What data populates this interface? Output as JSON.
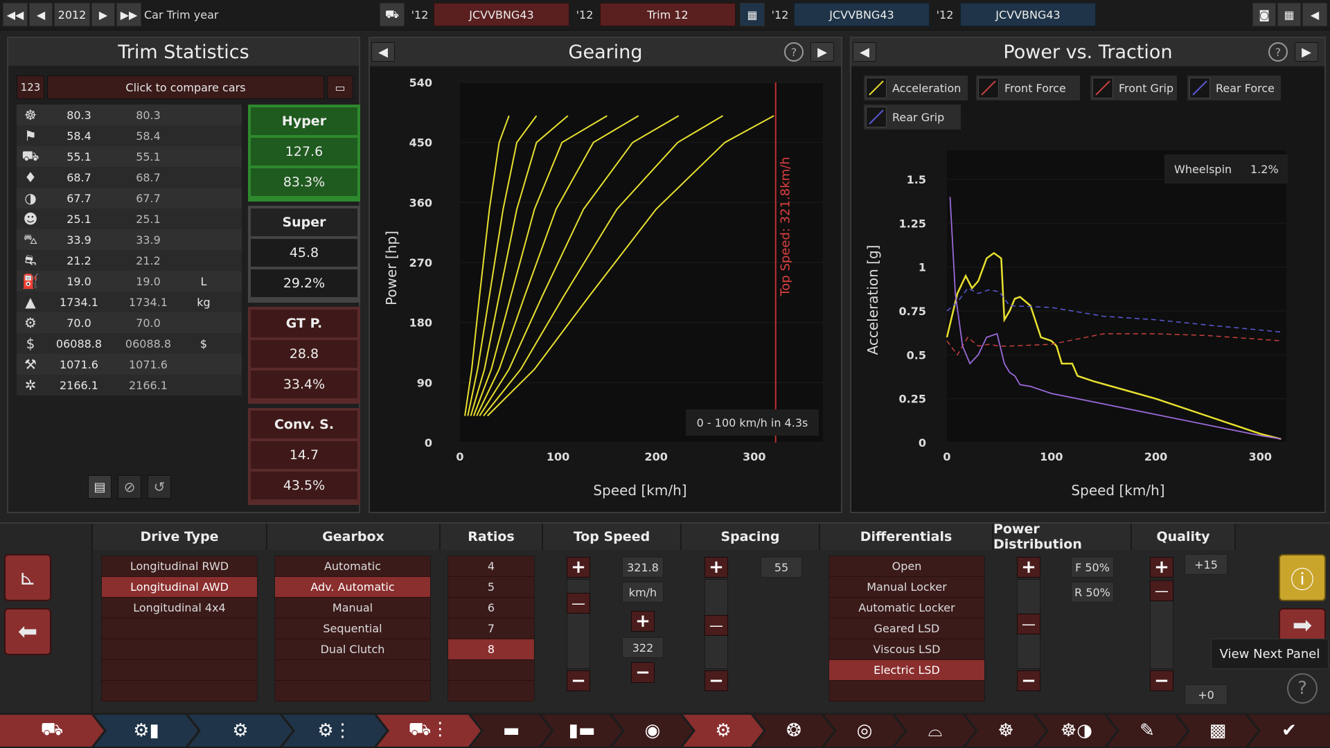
{
  "topbar": {
    "year": "2012",
    "year_label": "Car Trim year",
    "car_year_a": "'12",
    "car_a": "JCVVBNG43",
    "trim_year": "'12",
    "trim": "Trim 12",
    "car_year_b": "'12",
    "car_b": "JCVVBNG43",
    "car_year_c": "'12",
    "car_c": "JCVVBNG43"
  },
  "trim_stats": {
    "title": "Trim Statistics",
    "compare_num": "123",
    "compare_label": "Click to compare cars",
    "rows": [
      {
        "icon": "steering-wheel-icon",
        "glyph": "☸",
        "v1": "80.3",
        "v2": "80.3",
        "unit": ""
      },
      {
        "icon": "race-flag-icon",
        "glyph": "⚑",
        "v1": "58.4",
        "v2": "58.4",
        "unit": ""
      },
      {
        "icon": "seat-icon",
        "glyph": "⛟",
        "v1": "55.1",
        "v2": "55.1",
        "unit": ""
      },
      {
        "icon": "gem-icon",
        "glyph": "♦",
        "v1": "68.7",
        "v2": "68.7",
        "unit": ""
      },
      {
        "icon": "safety-icon",
        "glyph": "◑",
        "v1": "67.7",
        "v2": "67.7",
        "unit": ""
      },
      {
        "icon": "people-icon",
        "glyph": "☻",
        "v1": "25.1",
        "v2": "25.1",
        "unit": ""
      },
      {
        "icon": "car-side-icon",
        "glyph": "⛍",
        "v1": "33.9",
        "v2": "33.9",
        "unit": ""
      },
      {
        "icon": "car-wrench-icon",
        "glyph": "⛐",
        "v1": "21.2",
        "v2": "21.2",
        "unit": ""
      },
      {
        "icon": "fuel-icon",
        "glyph": "⛽",
        "v1": "19.0",
        "v2": "19.0",
        "unit": "L"
      },
      {
        "icon": "weight-icon",
        "glyph": "▲",
        "v1": "1734.1",
        "v2": "1734.1",
        "unit": "kg"
      },
      {
        "icon": "engine-hand-icon",
        "glyph": "⚙",
        "v1": "70.0",
        "v2": "70.0",
        "unit": ""
      },
      {
        "icon": "money-bag-icon",
        "glyph": "$",
        "v1": "06088.8",
        "v2": "06088.8",
        "unit": "$"
      },
      {
        "icon": "production-icon",
        "glyph": "⚒",
        "v1": "1071.6",
        "v2": "1071.6",
        "unit": ""
      },
      {
        "icon": "gears-icon",
        "glyph": "✲",
        "v1": "2166.1",
        "v2": "2166.1",
        "unit": ""
      }
    ],
    "classes": [
      {
        "name": "Hyper",
        "score": "127.6",
        "pct": "83.3%",
        "bg": "#1f5a1f",
        "border": "#2d8a2d"
      },
      {
        "name": "Super",
        "score": "45.8",
        "pct": "29.2%",
        "bg": "#1b1b1b",
        "border": "#444444"
      },
      {
        "name": "GT P.",
        "score": "28.8",
        "pct": "33.4%",
        "bg": "#3f1919",
        "border": "#5a2a2a"
      },
      {
        "name": "Conv. S.",
        "score": "14.7",
        "pct": "43.5%",
        "bg": "#3f1919",
        "border": "#5a2a2a"
      }
    ]
  },
  "gearing": {
    "title": "Gearing",
    "accel_label": "0 - 100 km/h in 4.3s",
    "top_speed_label": "Top Speed: 321.8km/h"
  },
  "power_traction": {
    "title": "Power vs. Traction",
    "legend": [
      {
        "name": "Acceleration",
        "color": "#e8e030"
      },
      {
        "name": "Front Force",
        "color": "#c84040"
      },
      {
        "name": "Front Grip",
        "color": "#c84040"
      },
      {
        "name": "Rear Force",
        "color": "#5a5ad8"
      },
      {
        "name": "Rear Grip",
        "color": "#5a5ad8"
      }
    ],
    "wheelspin_label": "Wheelspin",
    "wheelspin_value": "1.2%"
  },
  "chart_data": [
    {
      "type": "line",
      "title": "Gearing",
      "xlabel": "Speed [km/h]",
      "ylabel": "Power [hp]",
      "xlim": [
        0,
        370
      ],
      "ylim": [
        0,
        540
      ],
      "xticks": [
        0,
        100,
        200,
        300
      ],
      "yticks": [
        0,
        90,
        180,
        270,
        360,
        450,
        540
      ],
      "annotation_top_speed": 321.8,
      "series": [
        {
          "x": [
            5,
            12,
            20,
            30,
            40,
            50
          ],
          "y": [
            40,
            110,
            220,
            350,
            450,
            490
          ]
        },
        {
          "x": [
            8,
            18,
            30,
            44,
            58,
            78
          ],
          "y": [
            40,
            110,
            220,
            350,
            450,
            490
          ]
        },
        {
          "x": [
            11,
            25,
            40,
            58,
            78,
            110
          ],
          "y": [
            40,
            110,
            220,
            350,
            450,
            490
          ]
        },
        {
          "x": [
            14,
            32,
            52,
            76,
            104,
            150
          ],
          "y": [
            40,
            110,
            220,
            350,
            450,
            490
          ]
        },
        {
          "x": [
            17,
            40,
            66,
            98,
            136,
            182
          ],
          "y": [
            40,
            110,
            220,
            350,
            450,
            490
          ]
        },
        {
          "x": [
            20,
            50,
            84,
            126,
            176,
            223
          ],
          "y": [
            40,
            110,
            220,
            350,
            450,
            490
          ]
        },
        {
          "x": [
            24,
            62,
            106,
            160,
            222,
            268
          ],
          "y": [
            40,
            110,
            220,
            350,
            450,
            490
          ]
        },
        {
          "x": [
            28,
            76,
            132,
            200,
            270,
            320
          ],
          "y": [
            40,
            110,
            220,
            350,
            450,
            490
          ]
        }
      ]
    },
    {
      "type": "line",
      "title": "Power vs. Traction",
      "xlabel": "Speed [km/h]",
      "ylabel": "Acceleration [g]",
      "xlim": [
        0,
        325
      ],
      "ylim": [
        0,
        1.5
      ],
      "xticks": [
        0,
        100,
        200,
        300
      ],
      "yticks": [
        0,
        0.25,
        0.5,
        0.75,
        1,
        1.25,
        1.5
      ],
      "yticklabels": [
        "0",
        "0.25",
        "0.5",
        "0.75",
        "1",
        "1.25",
        "1.5"
      ],
      "series": [
        {
          "name": "Acceleration",
          "x": [
            0,
            10,
            18,
            24,
            30,
            38,
            45,
            52,
            55,
            60,
            65,
            70,
            80,
            90,
            100,
            105,
            110,
            120,
            125,
            140,
            170,
            200,
            250,
            300,
            320
          ],
          "y": [
            0.6,
            0.85,
            0.95,
            0.88,
            0.92,
            1.05,
            1.08,
            1.05,
            0.7,
            0.75,
            0.82,
            0.83,
            0.78,
            0.6,
            0.58,
            0.55,
            0.45,
            0.45,
            0.38,
            0.35,
            0.3,
            0.25,
            0.15,
            0.05,
            0.02
          ]
        },
        {
          "name": "Front Force",
          "x": [
            0,
            10,
            20,
            30,
            40,
            50,
            60,
            100,
            150,
            200,
            250,
            320
          ],
          "y": [
            0.58,
            0.5,
            0.6,
            0.55,
            0.56,
            0.55,
            0.55,
            0.56,
            0.62,
            0.62,
            0.61,
            0.58
          ]
        },
        {
          "name": "Rear Force",
          "x": [
            0,
            10,
            20,
            30,
            40,
            50,
            60,
            100,
            150,
            200,
            250,
            320
          ],
          "y": [
            0.75,
            0.8,
            0.88,
            0.85,
            0.87,
            0.86,
            0.78,
            0.77,
            0.72,
            0.7,
            0.67,
            0.63
          ]
        },
        {
          "name": "Rear Grip",
          "x": [
            3,
            8,
            15,
            22,
            30,
            38,
            48,
            55,
            60,
            65,
            70,
            80,
            90,
            100,
            150,
            200,
            250,
            300,
            320
          ],
          "y": [
            1.4,
            0.85,
            0.55,
            0.45,
            0.5,
            0.6,
            0.62,
            0.45,
            0.4,
            0.38,
            0.33,
            0.32,
            0.3,
            0.28,
            0.22,
            0.16,
            0.1,
            0.04,
            0.02
          ]
        }
      ]
    }
  ],
  "bottom": {
    "drive_type": {
      "title": "Drive Type",
      "items": [
        "Longitudinal RWD",
        "Longitudinal AWD",
        "Longitudinal 4x4"
      ],
      "selected": 1
    },
    "gearbox": {
      "title": "Gearbox",
      "items": [
        "Automatic",
        "Adv. Automatic",
        "Manual",
        "Sequential",
        "Dual Clutch"
      ],
      "selected": 1
    },
    "ratios": {
      "title": "Ratios",
      "items": [
        "4",
        "5",
        "6",
        "7",
        "8"
      ],
      "selected": 4
    },
    "top_speed": {
      "title": "Top Speed",
      "value": "321.8",
      "unit": "km/h",
      "target": "322"
    },
    "spacing": {
      "title": "Spacing",
      "value": "55"
    },
    "differentials": {
      "title": "Differentials",
      "items": [
        "Open",
        "Manual Locker",
        "Automatic Locker",
        "Geared LSD",
        "Viscous LSD",
        "Electric LSD"
      ],
      "selected": 5
    },
    "power_distribution": {
      "title": "Power Distribution",
      "front": "F 50%",
      "rear": "R 50%"
    },
    "quality": {
      "title": "Quality",
      "top": "+15",
      "bottom": "+0"
    },
    "tooltip": "View Next Panel"
  }
}
